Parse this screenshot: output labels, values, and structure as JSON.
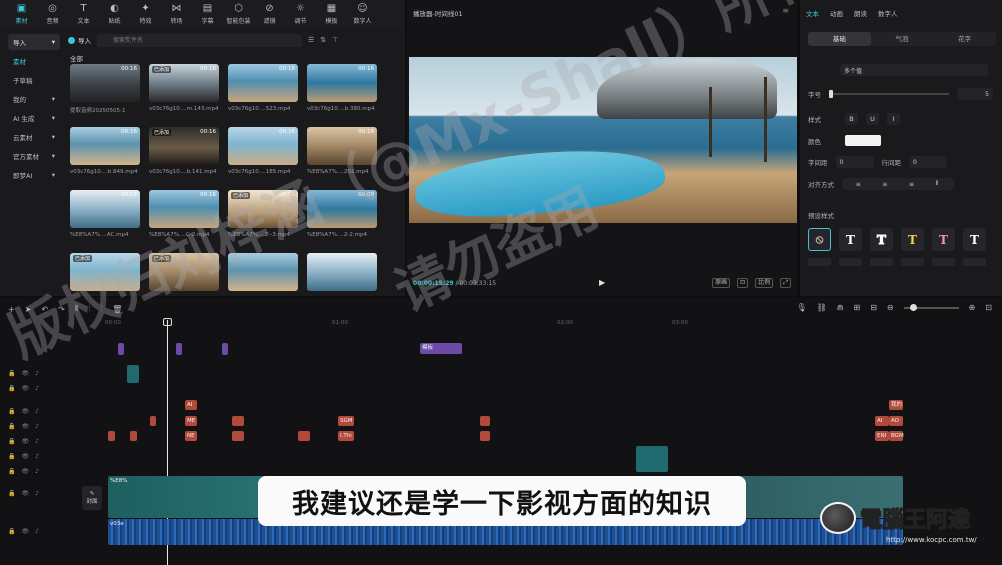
{
  "toolbar": {
    "items": [
      {
        "label": "素材",
        "icon": "media-icon"
      },
      {
        "label": "音频",
        "icon": "audio-icon"
      },
      {
        "label": "文本",
        "icon": "text-icon"
      },
      {
        "label": "贴纸",
        "icon": "sticker-icon"
      },
      {
        "label": "特效",
        "icon": "effects-icon"
      },
      {
        "label": "转场",
        "icon": "transition-icon"
      },
      {
        "label": "字幕",
        "icon": "subtitle-icon"
      },
      {
        "label": "智能包装",
        "icon": "smart-pack-icon"
      },
      {
        "label": "滤镜",
        "icon": "filter-icon"
      },
      {
        "label": "调节",
        "icon": "adjust-icon"
      },
      {
        "label": "模板",
        "icon": "template-icon"
      },
      {
        "label": "数字人",
        "icon": "avatar-icon"
      }
    ]
  },
  "media": {
    "categories": [
      "导入",
      "素材",
      "子草稿",
      "我的",
      "AI 生成",
      "云素材",
      "官方素材",
      "即梦AI"
    ],
    "import_label": "导入",
    "search_placeholder": "搜索文件名",
    "all_label": "全部",
    "clips": [
      {
        "dur": "00:16",
        "added": "",
        "name": "提取音频20250505-1"
      },
      {
        "dur": "00:16",
        "added": "已添加",
        "name": "v03c76g10....m.143.mp4"
      },
      {
        "dur": "00:16",
        "added": "",
        "name": "v03c76g10....523.mp4"
      },
      {
        "dur": "00:16",
        "added": "",
        "name": "v03c76g10....b.380.mp4"
      },
      {
        "dur": "00:16",
        "added": "",
        "name": "v03c76g10....b.849.mp4"
      },
      {
        "dur": "00:16",
        "added": "已添加",
        "name": "v03c76g10....b.141.mp4"
      },
      {
        "dur": "00:16",
        "added": "",
        "name": "v03c76g10....185.mp4"
      },
      {
        "dur": "00:16",
        "added": "",
        "name": "%E8%A7%....202.mp4"
      },
      {
        "dur": "00:16",
        "added": "",
        "name": "%E8%A7%....AC.mp4"
      },
      {
        "dur": "00:16",
        "added": "",
        "name": "%E8%A7%....C-2.mp4"
      },
      {
        "dur": "00:16",
        "added": "已添加",
        "name": "%E8%A7%....2--3.mp4"
      },
      {
        "dur": "00:09",
        "added": "",
        "name": "%E8%A7%....2-2.mp4"
      },
      {
        "dur": "",
        "added": "已添加",
        "name": ""
      },
      {
        "dur": "",
        "added": "已添加",
        "name": ""
      },
      {
        "dur": "",
        "added": "",
        "name": ""
      },
      {
        "dur": "",
        "added": "",
        "name": ""
      }
    ]
  },
  "player": {
    "title": "播放器-时间线01",
    "current_time": "00:00:15:29",
    "total_time": "00:03:33:15",
    "btn_original": "原画",
    "btn_ratio": "比例"
  },
  "props": {
    "tabs": [
      "文本",
      "动画",
      "朗读",
      "数字人"
    ],
    "segments": [
      "基础",
      "气泡",
      "花字"
    ],
    "font_value": "多个值",
    "size_label": "字号",
    "size_value": "5",
    "style_label": "样式",
    "color_label": "颜色",
    "char_spacing_label": "字间距",
    "char_spacing_value": "0",
    "line_spacing_label": "行间距",
    "line_spacing_value": "0",
    "align_label": "对齐方式",
    "preset_label": "预设样式",
    "preset_glyph": "T"
  },
  "timeline": {
    "ticks": [
      "00:00",
      "01:00",
      "02:00",
      "03:00"
    ],
    "clip_labels": [
      "AI",
      "ME",
      "NE",
      "SGM",
      "I.Thi",
      "AI",
      "AO",
      "ENI",
      "BGM",
      "我的"
    ],
    "main_clip_label": "%E8%",
    "cover_label": "封面",
    "audio_label": "v03e",
    "sticker_label": "模板",
    "end_text": "重置样式"
  },
  "overlay": {
    "subtitle": "我建议还是学一下影视方面的知识",
    "watermark_1": "版权归刘梓涵（@Mx-Shall）所有",
    "watermark_2": "请勿盗用",
    "logo_title": "電腦王阿達",
    "logo_url": "http://www.kocpc.com.tw/"
  },
  "colors": {
    "accent": "#3cc7d9",
    "panel": "#1a1a1d",
    "text_clip": "#b24a3b"
  }
}
